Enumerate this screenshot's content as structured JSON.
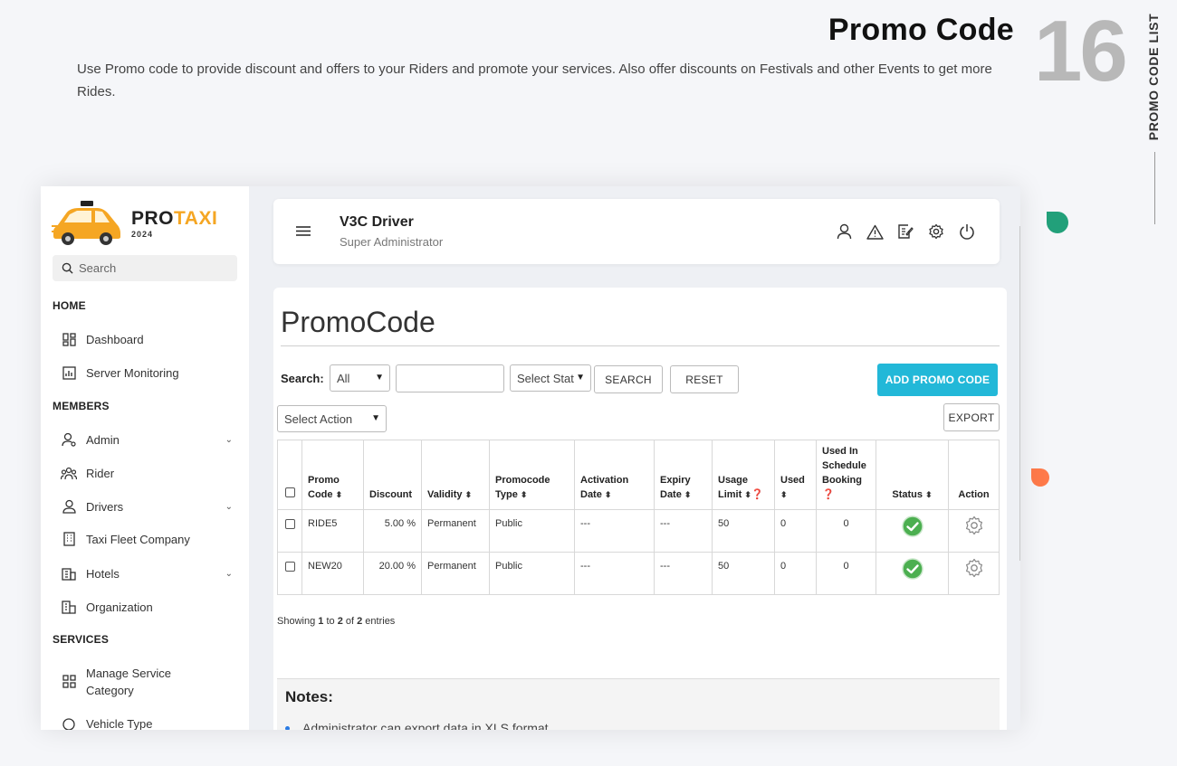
{
  "hero": {
    "title": "Promo Code",
    "number": "16",
    "description": "Use Promo code to provide discount and offers to your Riders and promote your services. Also offer discounts on Festivals and other Events to get more Rides.",
    "side_label": "PROMO CODE LIST"
  },
  "colors": {
    "accent": "#22b8d8",
    "brand": "#f5a623",
    "status_ok": "#4caf50"
  },
  "sidebar": {
    "brand_pro": "PRO",
    "brand_taxi": "TAXI",
    "brand_year": "2024",
    "search_placeholder": "Search",
    "sections": {
      "home": "HOME",
      "members": "MEMBERS",
      "services": "SERVICES"
    },
    "items": [
      {
        "label": "Dashboard",
        "icon": "dashboard-icon"
      },
      {
        "label": "Server Monitoring",
        "icon": "chart-icon"
      },
      {
        "label": "Admin",
        "icon": "admin-icon"
      },
      {
        "label": "Rider",
        "icon": "users-icon"
      },
      {
        "label": "Drivers",
        "icon": "driver-icon"
      },
      {
        "label": "Taxi Fleet Company",
        "icon": "building-icon"
      },
      {
        "label": "Hotels",
        "icon": "hotel-icon"
      },
      {
        "label": "Organization",
        "icon": "organization-icon"
      },
      {
        "label": "Manage Service Category",
        "icon": "grid-icon"
      },
      {
        "label": "Vehicle Type",
        "icon": "vehicle-icon"
      }
    ]
  },
  "topbar": {
    "user_name": "V3C Driver",
    "user_role": "Super Administrator"
  },
  "panel": {
    "title": "PromoCode",
    "search_label": "Search:",
    "search_field_select": "All",
    "status_select": "Select Stat",
    "search_button": "SEARCH",
    "reset_button": "RESET",
    "add_button": "ADD PROMO CODE",
    "action_select": "Select Action",
    "export_button": "EXPORT"
  },
  "table": {
    "headers": {
      "promo_code": "Promo Code",
      "discount": "Discount",
      "validity": "Validity",
      "type": "Promocode Type",
      "activation": "Activation Date",
      "expiry": "Expiry Date",
      "usage_limit": "Usage Limit",
      "used": "Used",
      "used_schedule": "Used In Schedule Booking",
      "status": "Status",
      "action": "Action"
    },
    "rows": [
      {
        "code": "RIDE5",
        "discount": "5.00 %",
        "validity": "Permanent",
        "type": "Public",
        "activation": "---",
        "expiry": "---",
        "usage_limit": "50",
        "used": "0",
        "used_schedule": "0"
      },
      {
        "code": "NEW20",
        "discount": "20.00 %",
        "validity": "Permanent",
        "type": "Public",
        "activation": "---",
        "expiry": "---",
        "usage_limit": "50",
        "used": "0",
        "used_schedule": "0"
      }
    ]
  },
  "showing": {
    "prefix": "Showing ",
    "from": "1",
    "to_word": " to ",
    "to": "2",
    "of_word": " of ",
    "total": "2",
    "suffix": " entries"
  },
  "notes": {
    "title": "Notes:",
    "items": [
      "Administrator can export data in XLS format."
    ]
  }
}
